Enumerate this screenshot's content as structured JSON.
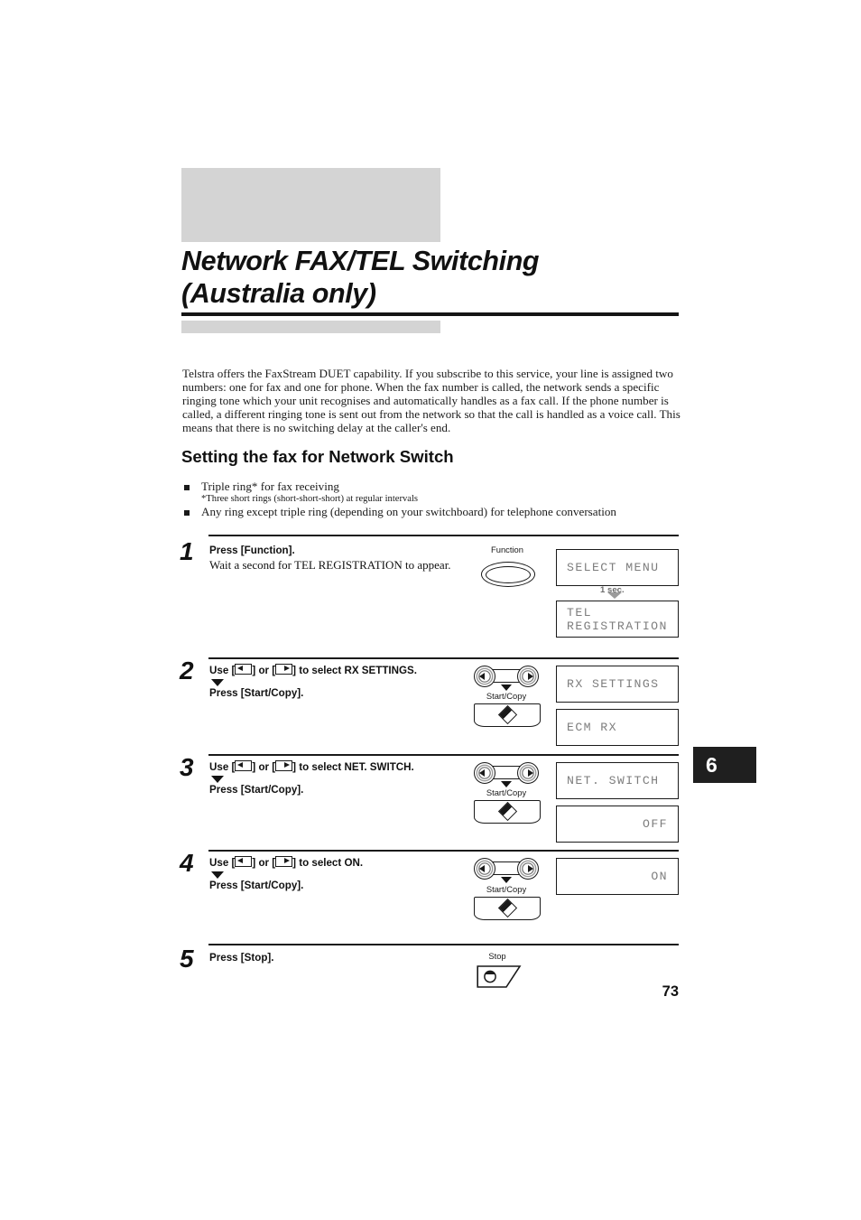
{
  "document": {
    "title": "Network FAX/TEL Switching\n(Australia only)",
    "page_number": "73",
    "chapter_tab": "6",
    "intro_paragraph": "Telstra offers the FaxStream DUET capability. If you subscribe to this service, your line is assigned two numbers: one for fax and one for phone. When the fax number is called, the network sends a specific ringing tone which your unit recognises and automatically handles as a fax call. If the phone number is called, a different ringing tone is sent out from the network so that the call is handled as a voice call. This means that there is no switching delay at the caller's end.",
    "section_heading": "Setting the fax for Network Switch",
    "bullets": {
      "item1": "Triple ring* for fax receiving",
      "note1": "*Three short rings (short-short-short) at regular intervals",
      "item2": "Any ring except triple ring (depending on your switchboard) for telephone conversation"
    }
  },
  "steps": [
    {
      "number": "1",
      "instruction": "Press [Function].",
      "sub_instruction": "Wait a second for TEL REGISTRATION to appear.",
      "button_label": "Function",
      "lcd1": "SELECT MENU",
      "delay_label": "1 sec.",
      "lcd2": "TEL REGISTRATION"
    },
    {
      "number": "2",
      "instruction_prefix": "Use [",
      "instruction_mid": "] or [",
      "instruction_suffix": "] to select RX SETTINGS.",
      "instruction_second": "Press [Start/Copy].",
      "button_label": "Start/Copy",
      "lcd1": "RX SETTINGS",
      "lcd2": "ECM RX"
    },
    {
      "number": "3",
      "instruction_prefix": "Use [",
      "instruction_mid": "] or [",
      "instruction_suffix": "] to select NET. SWITCH.",
      "instruction_second": "Press [Start/Copy].",
      "button_label": "Start/Copy",
      "lcd1": "NET. SWITCH",
      "lcd2": "OFF"
    },
    {
      "number": "4",
      "instruction_prefix": "Use [",
      "instruction_mid": "] or [",
      "instruction_suffix": "] to select ON.",
      "instruction_second": "Press [Start/Copy].",
      "button_label": "Start/Copy",
      "lcd1": "ON"
    },
    {
      "number": "5",
      "instruction": "Press [Stop].",
      "button_label": "Stop"
    }
  ],
  "colors": {
    "band_gray": "#d4d4d4",
    "rule_black": "#141414",
    "lcd_text": "#7d7d7d",
    "tab_black": "#1f1f1f"
  }
}
